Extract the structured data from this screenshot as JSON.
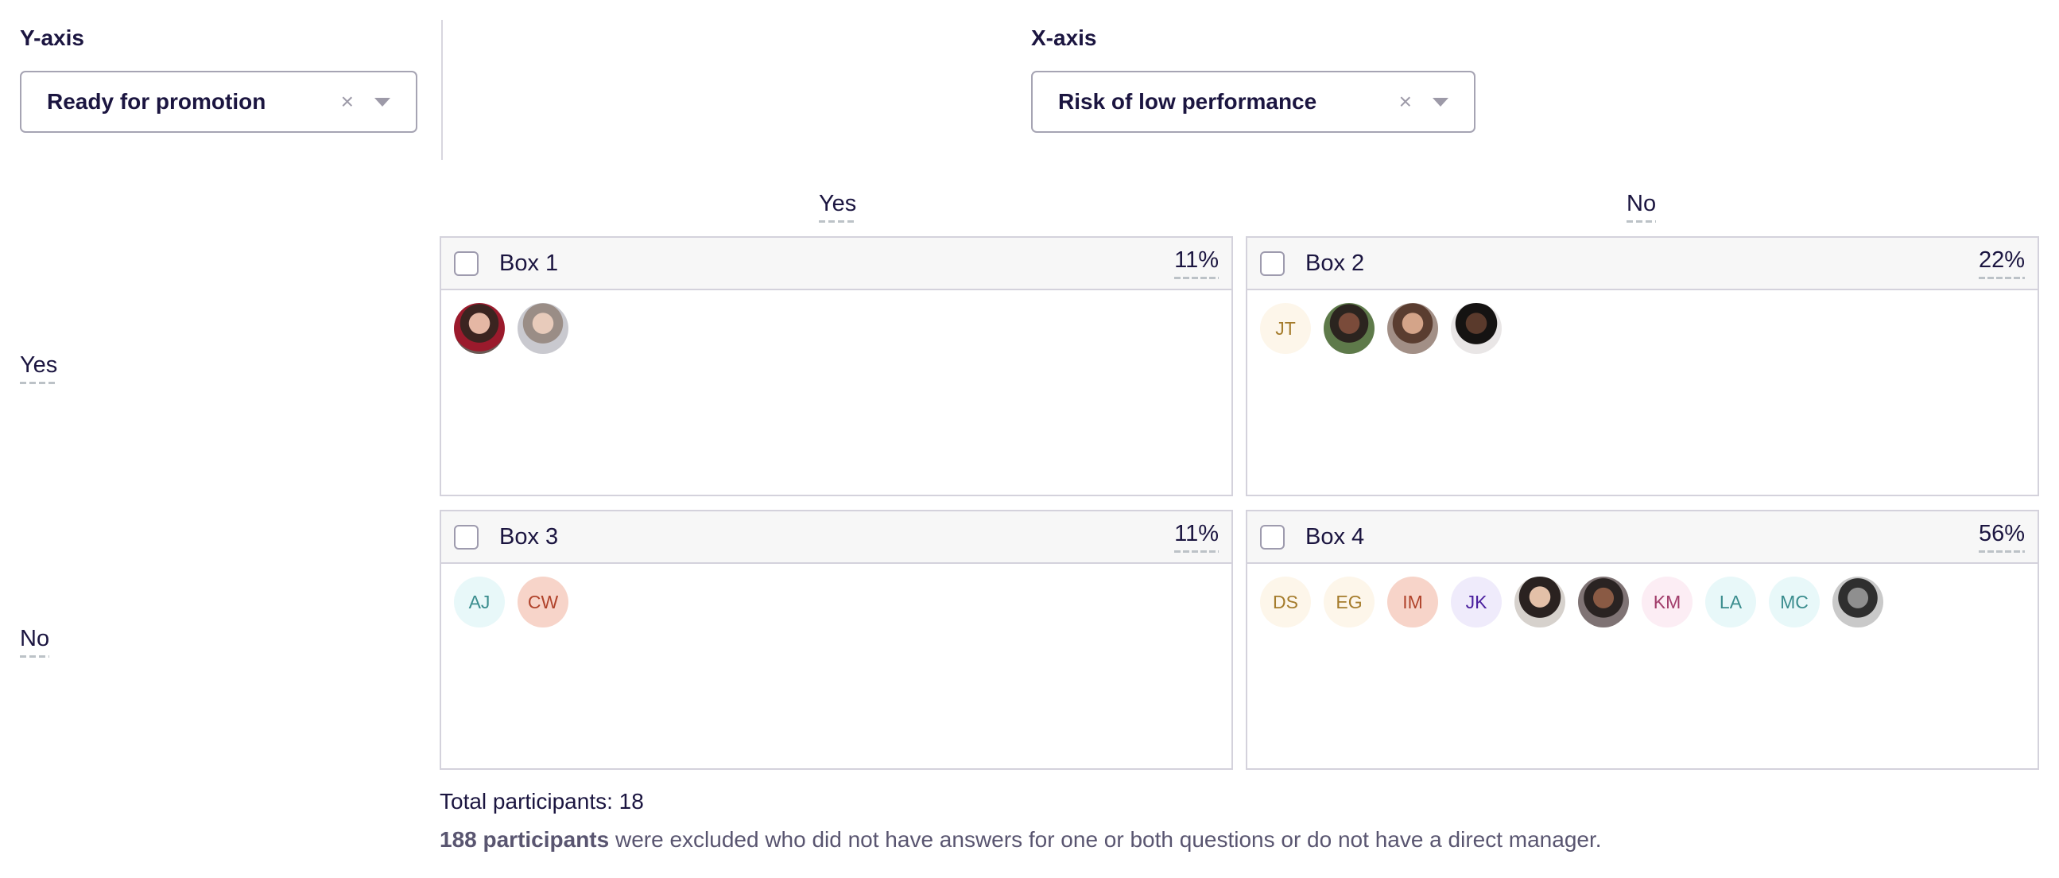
{
  "y_axis": {
    "label": "Y-axis",
    "selected": "Ready for promotion",
    "clear_icon": "×",
    "rows": [
      "Yes",
      "No"
    ]
  },
  "x_axis": {
    "label": "X-axis",
    "selected": "Risk of low performance",
    "clear_icon": "×",
    "columns": [
      "Yes",
      "No"
    ]
  },
  "boxes": [
    {
      "title": "Box 1",
      "percent": "11%",
      "avatars": [
        {
          "type": "photo",
          "variant": "p1"
        },
        {
          "type": "photo",
          "variant": "p2"
        }
      ]
    },
    {
      "title": "Box 2",
      "percent": "22%",
      "avatars": [
        {
          "type": "initials",
          "text": "JT",
          "bg": "#fdf6ea",
          "fg": "#a57c2c"
        },
        {
          "type": "photo",
          "variant": "p3"
        },
        {
          "type": "photo",
          "variant": "p4"
        },
        {
          "type": "photo",
          "variant": "p5"
        }
      ]
    },
    {
      "title": "Box 3",
      "percent": "11%",
      "avatars": [
        {
          "type": "initials",
          "text": "AJ",
          "bg": "#e8f8f9",
          "fg": "#3a8d8e"
        },
        {
          "type": "initials",
          "text": "CW",
          "bg": "#f7d4c9",
          "fg": "#b0432b"
        }
      ]
    },
    {
      "title": "Box 4",
      "percent": "56%",
      "avatars": [
        {
          "type": "initials",
          "text": "DS",
          "bg": "#fdf6ea",
          "fg": "#a57c2c"
        },
        {
          "type": "initials",
          "text": "EG",
          "bg": "#fdf6ea",
          "fg": "#a57c2c"
        },
        {
          "type": "initials",
          "text": "IM",
          "bg": "#f7d4c9",
          "fg": "#b0432b"
        },
        {
          "type": "initials",
          "text": "JK",
          "bg": "#efebfb",
          "fg": "#4a1f9e"
        },
        {
          "type": "photo",
          "variant": "p6"
        },
        {
          "type": "photo",
          "variant": "p7"
        },
        {
          "type": "initials",
          "text": "KM",
          "bg": "#fcedf4",
          "fg": "#a23d6b"
        },
        {
          "type": "initials",
          "text": "LA",
          "bg": "#e8f8f9",
          "fg": "#3a8d8e"
        },
        {
          "type": "initials",
          "text": "MC",
          "bg": "#e8f8f9",
          "fg": "#3a8d8e"
        },
        {
          "type": "photo",
          "variant": "p8"
        }
      ]
    }
  ],
  "footer": {
    "total": "Total participants: 18",
    "excluded_count": "188 participants",
    "excluded_text": " were excluded who did not have answers for one or both questions or do not have a direct manager."
  }
}
